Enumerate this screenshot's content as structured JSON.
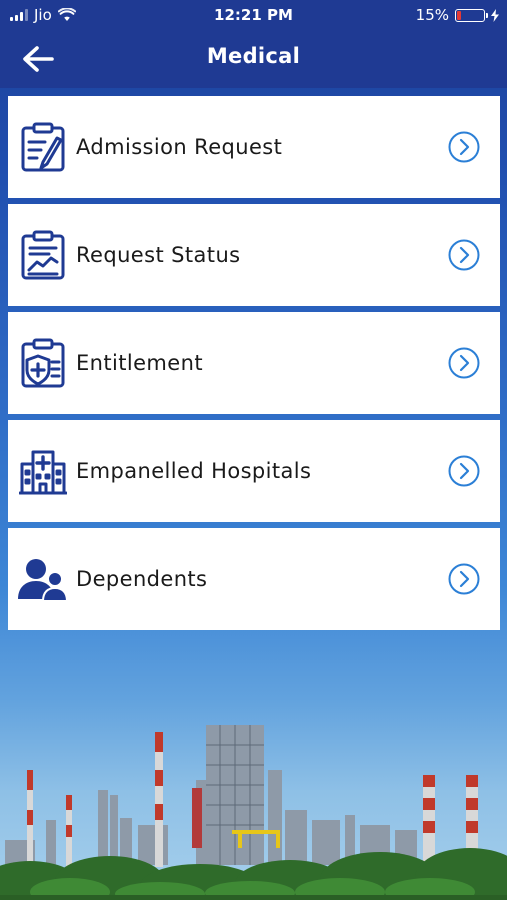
{
  "status_bar": {
    "carrier": "Jio",
    "time": "12:21 PM",
    "battery": "15%",
    "battery_level": 0.15
  },
  "header": {
    "title": "Medical",
    "back_icon": "arrow-left-icon"
  },
  "menu": {
    "items": [
      {
        "label": "Admission Request",
        "icon": "clipboard-edit-icon"
      },
      {
        "label": "Request Status",
        "icon": "clipboard-chart-icon"
      },
      {
        "label": "Entitlement",
        "icon": "medical-shield-icon"
      },
      {
        "label": "Empanelled Hospitals",
        "icon": "hospital-building-icon"
      },
      {
        "label": "Dependents",
        "icon": "people-icon"
      }
    ]
  },
  "colors": {
    "header": "#1f3a93",
    "icon": "#1f3a93",
    "chevron": "#2b7fd6",
    "card": "#ffffff",
    "battery_low": "#e53935"
  }
}
